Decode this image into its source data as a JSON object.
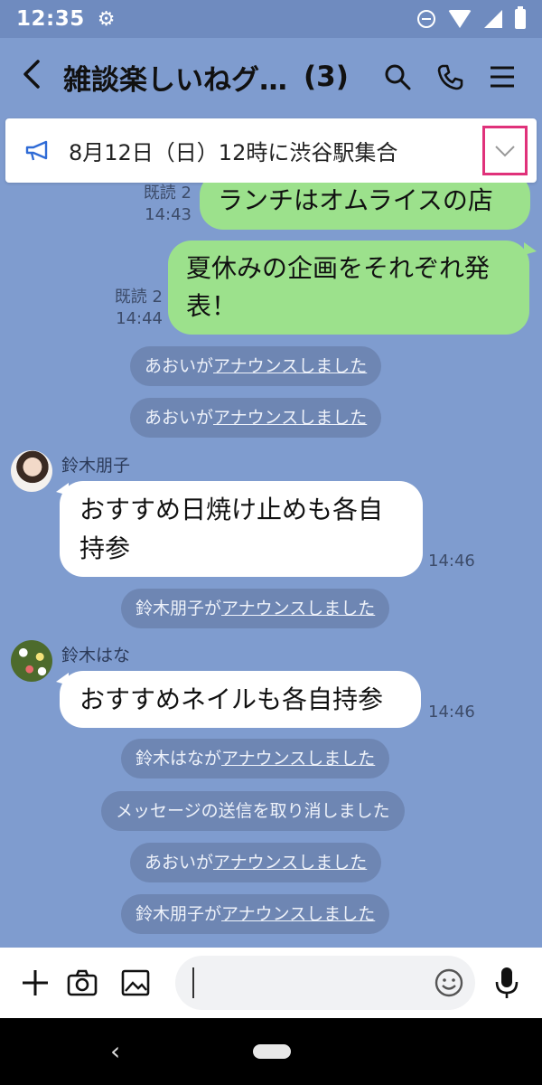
{
  "status_bar": {
    "time": "12:35"
  },
  "header": {
    "back_icon": "chevron-left-icon",
    "title": "雑談楽しいねグ…",
    "member_count": "(3)",
    "icons": [
      "search-icon",
      "phone-icon",
      "menu-icon"
    ]
  },
  "announcement": {
    "icon": "megaphone-icon",
    "text": "8月12日（日）12時に渋谷駅集合",
    "toggle_icon": "chevron-down-icon",
    "highlight_color": "#e0317a"
  },
  "messages": {
    "out1": {
      "text": "ランチはオムライスの店",
      "read": "既読 2",
      "time": "14:43"
    },
    "out2": {
      "line1": "夏休みの企画をそれぞれ発",
      "line2": "表！",
      "read": "既読 2",
      "time": "14:44"
    },
    "sys1": {
      "prefix": "あおいが",
      "link": "アナウンスしました"
    },
    "sys2": {
      "prefix": "あおいが",
      "link": "アナウンスしました"
    },
    "in1": {
      "sender": "鈴木朋子",
      "line1": "おすすめ日焼け止めも各自",
      "line2": "持参",
      "time": "14:46"
    },
    "sys3": {
      "prefix": "鈴木朋子が",
      "link": "アナウンスしました"
    },
    "in2": {
      "sender": "鈴木はな",
      "text": "おすすめネイルも各自持参",
      "time": "14:46"
    },
    "sys4": {
      "prefix": "鈴木はなが",
      "link": "アナウンスしました"
    },
    "sys5": {
      "text": "メッセージの送信を取り消しました"
    },
    "sys6": {
      "prefix": "あおいが",
      "link": "アナウンスしました"
    },
    "sys7": {
      "prefix": "鈴木朋子が",
      "link": "アナウンスしました"
    }
  },
  "input_bar": {
    "icons": [
      "plus-icon",
      "camera-icon",
      "image-icon",
      "emoji-icon",
      "microphone-icon"
    ],
    "message_value": ""
  },
  "colors": {
    "chat_background": "#7f9ccf",
    "outgoing_bubble": "#9ce18c",
    "incoming_bubble": "#ffffff",
    "system_pill": "#6e86b3"
  }
}
